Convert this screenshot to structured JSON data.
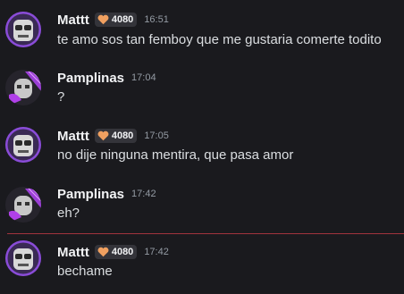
{
  "messages": [
    {
      "author": "Mattt",
      "badge": "4080",
      "time": "16:51",
      "text": "te amo sos tan femboy que me gustaria comerte todito"
    },
    {
      "author": "Pamplinas",
      "time": "17:04",
      "text": "?"
    },
    {
      "author": "Mattt",
      "badge": "4080",
      "time": "17:05",
      "text": "no dije ninguna mentira, que pasa amor"
    },
    {
      "author": "Pamplinas",
      "time": "17:42",
      "text": "eh?"
    },
    {
      "author": "Mattt",
      "badge": "4080",
      "time": "17:42",
      "text": "bechame"
    }
  ],
  "colors": {
    "background": "#1a1a1e",
    "username": "#f2f3f5",
    "message_text": "#dbdee1",
    "timestamp": "#949ba4",
    "new_messages_divider": "#a1333e",
    "badge_heart": "#f0a060"
  },
  "icons": {
    "badge": "heart-icon"
  }
}
